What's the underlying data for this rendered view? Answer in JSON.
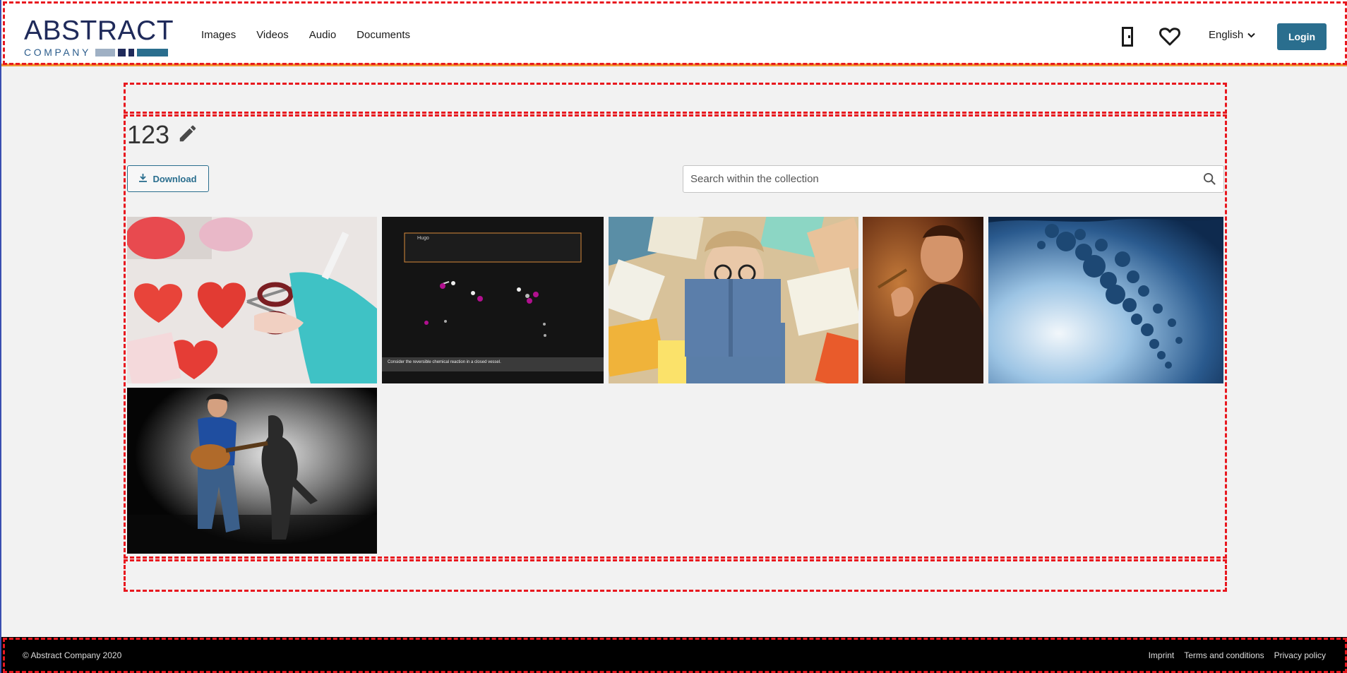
{
  "header": {
    "logo_main": "ABSTRACT",
    "logo_sub": "COMPANY",
    "nav": [
      "Images",
      "Videos",
      "Audio",
      "Documents"
    ],
    "language": "English",
    "login_label": "Login",
    "icons": [
      "door-icon",
      "heart-icon",
      "chevron-down-icon"
    ]
  },
  "collection": {
    "title": "123",
    "download_label": "Download",
    "search_placeholder": "Search within the collection",
    "icons": [
      "pencil-icon",
      "download-icon",
      "search-icon"
    ]
  },
  "thumbnails": {
    "video_box_label": "Hugo",
    "video_caption": "Consider the reversible chemical reaction in a closed vessel."
  },
  "footer": {
    "copyright": "© Abstract Company 2020",
    "links": [
      "Imprint",
      "Terms and conditions",
      "Privacy policy"
    ]
  },
  "colors": {
    "accent": "#2a6e8e",
    "header_border": "#f09a36",
    "logo_navy": "#1f2a5a"
  }
}
